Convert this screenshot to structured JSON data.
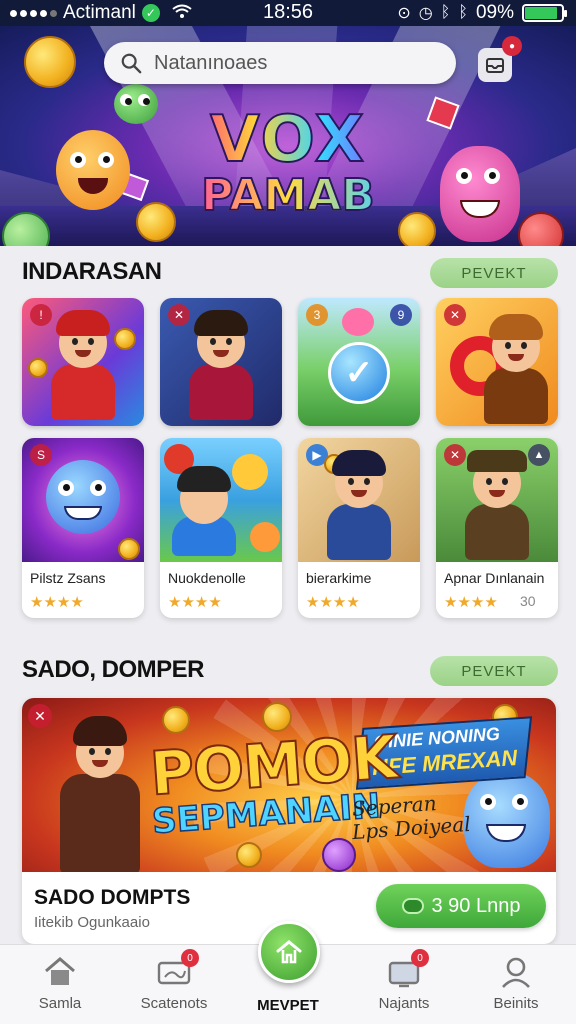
{
  "status_bar": {
    "carrier": "Actimanl",
    "time": "18:56",
    "battery_percent": "09%",
    "battery_level": 0.9
  },
  "hero": {
    "search_placeholder": "Natanınoaes",
    "logo_line1": "VOX",
    "logo_line2": "PAMAB"
  },
  "section1": {
    "title": "INDARASAN",
    "action": "PEVEKT"
  },
  "cards": [
    {
      "name": "Pilstz Zsans",
      "stars": "★★★★",
      "rating": ""
    },
    {
      "name": "Nuokdenolle",
      "stars": "★★★★",
      "rating": ""
    },
    {
      "name": "bierarkime",
      "stars": "★★★★",
      "rating": ""
    },
    {
      "name": "Apnar Dınlanain",
      "stars": "★★★★",
      "rating": "30"
    }
  ],
  "section2": {
    "title": "SADO, DOMPER",
    "action": "PEVEKT"
  },
  "banner": {
    "title_main": "POMOK",
    "title_sub": "SEPMANAIN",
    "ribbon_line1": "GINIE NONING",
    "ribbon_line2": "HFE MREXAN",
    "tagline_1": "Seperan",
    "tagline_2": "Lps Doiyeal",
    "name": "SADO DOMPTS",
    "subtitle": "Iitekib Ogunkaaio",
    "button": "3 90 Lnnp"
  },
  "nav": {
    "items": [
      {
        "label": "Samla",
        "icon": "home-icon"
      },
      {
        "label": "Scatenots",
        "icon": "ticket-icon",
        "badge": "0"
      },
      {
        "label": "MEVPET",
        "icon": "home-fab-icon"
      },
      {
        "label": "Najants",
        "icon": "tv-icon",
        "badge": "0"
      },
      {
        "label": "Beinits",
        "icon": "profile-icon"
      }
    ]
  },
  "colors": {
    "accent_green": "#3fa83a",
    "pill_green": "#9bd287",
    "badge_red": "#d8283c",
    "star": "#f0a92a"
  }
}
